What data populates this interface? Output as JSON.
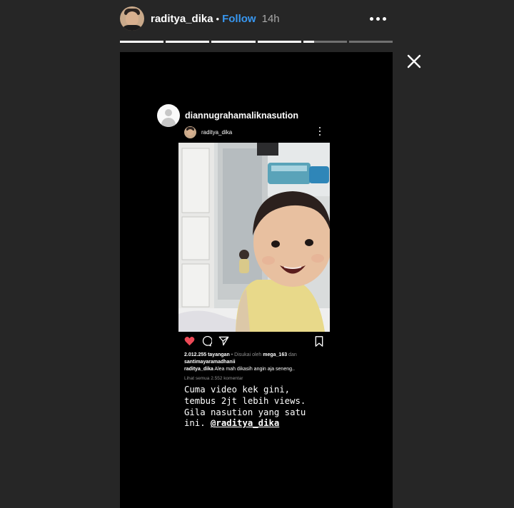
{
  "header": {
    "username": "raditya_dika",
    "separator": "•",
    "follow_label": "Follow",
    "time": "14h"
  },
  "progress": [
    1,
    1,
    1,
    1,
    0.25,
    0
  ],
  "story": {
    "repost_username": "diannugrahamaliknasution",
    "post": {
      "username": "raditya_dika",
      "views": "2.012.255 tayangan",
      "liked_prefix": " • Disukai oleh ",
      "liked_user": "mega_163",
      "liked_and": " dan",
      "liked_second": "santimayaramadhanii",
      "caption_user": "raditya_dika",
      "caption_text": " Alea mah dikasih angin aja seneng..",
      "view_comments": "Lihat semua 2.552 komentar"
    },
    "caption_lines": [
      "Cuma video kek gini,",
      "tembus 2jt lebih views.",
      "Gila nasution yang satu"
    ],
    "caption_last_prefix": "ini. ",
    "caption_mention": "@raditya_dika"
  },
  "colors": {
    "background": "#262626",
    "story_bg": "#000000",
    "follow": "#3897f0",
    "heart": "#ed4956"
  }
}
